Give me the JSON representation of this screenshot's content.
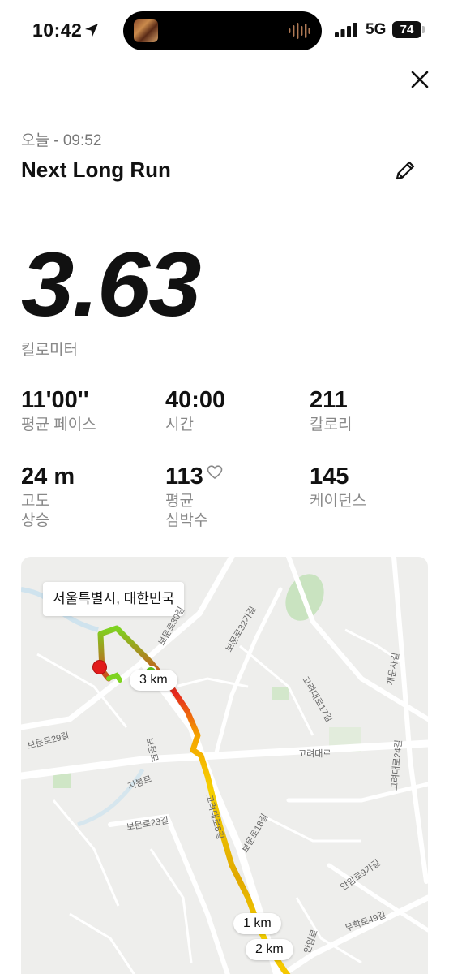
{
  "status_bar": {
    "time": "10:42",
    "network": "5G",
    "battery": "74",
    "icons": [
      "location-arrow-icon",
      "audio-wave-icon",
      "signal-bars-icon"
    ]
  },
  "header": {
    "date": "오늘 - 09:52",
    "title": "Next Long Run",
    "icons": [
      "close-icon",
      "pencil-icon"
    ]
  },
  "summary": {
    "distance": "3.63",
    "distance_unit": "킬로미터"
  },
  "stats": {
    "pace": {
      "value": "11'00''",
      "label": "평균 페이스"
    },
    "time": {
      "value": "40:00",
      "label": "시간"
    },
    "calories": {
      "value": "211",
      "label": "칼로리"
    },
    "elevation": {
      "value": "24 m",
      "label_line1": "고도",
      "label_line2": "상승"
    },
    "heart_rate": {
      "value": "113",
      "label_line1": "평균",
      "label_line2": "심박수"
    },
    "cadence": {
      "value": "145",
      "label": "케이던스"
    }
  },
  "map": {
    "location": "서울특별시, 대한민국",
    "km_markers": [
      "3 km",
      "1 km",
      "2 km"
    ],
    "road_labels": [
      "고려대로",
      "고려대로8길",
      "지봉로",
      "보문로29길",
      "보문로30길",
      "보문로32가길",
      "고려대로17길",
      "개운사길",
      "고려대로24길",
      "보문로23길",
      "보문로18길",
      "안암로",
      "무학로49길",
      "안암로9가길",
      "보문로"
    ],
    "colors": {
      "route_fast": "#7ed321",
      "route_mid": "#f5d000",
      "route_slow": "#e5261e",
      "start": "#e21b1b"
    }
  }
}
